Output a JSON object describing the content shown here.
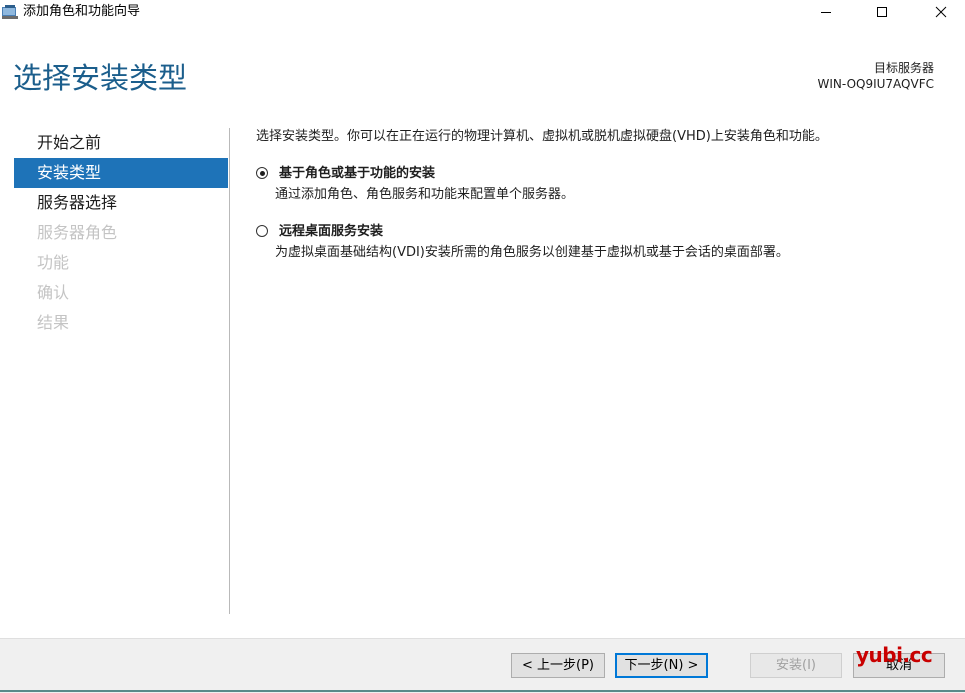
{
  "window": {
    "title": "添加角色和功能向导"
  },
  "header": {
    "page_title": "选择安装类型",
    "destination_label": "目标服务器",
    "destination_server": "WIN-OQ9IU7AQVFC"
  },
  "nav": {
    "items": [
      {
        "label": "开始之前",
        "state": "normal"
      },
      {
        "label": "安装类型",
        "state": "active"
      },
      {
        "label": "服务器选择",
        "state": "normal"
      },
      {
        "label": "服务器角色",
        "state": "disabled"
      },
      {
        "label": "功能",
        "state": "disabled"
      },
      {
        "label": "确认",
        "state": "disabled"
      },
      {
        "label": "结果",
        "state": "disabled"
      }
    ]
  },
  "main": {
    "intro": "选择安装类型。你可以在正在运行的物理计算机、虚拟机或脱机虚拟硬盘(VHD)上安装角色和功能。",
    "options": [
      {
        "title": "基于角色或基于功能的安装",
        "description": "通过添加角色、角色服务和功能来配置单个服务器。",
        "selected": true
      },
      {
        "title": "远程桌面服务安装",
        "description": "为虚拟桌面基础结构(VDI)安装所需的角色服务以创建基于虚拟机或基于会话的桌面部署。",
        "selected": false
      }
    ]
  },
  "footer": {
    "prev_label": "< 上一步(P)",
    "next_label": "下一步(N) >",
    "install_label": "安装(I)",
    "cancel_label": "取消",
    "watermark": "yubi.cc"
  },
  "colors": {
    "accent": "#1e73b8",
    "title": "#1b5e8c",
    "watermark": "#c90000"
  }
}
